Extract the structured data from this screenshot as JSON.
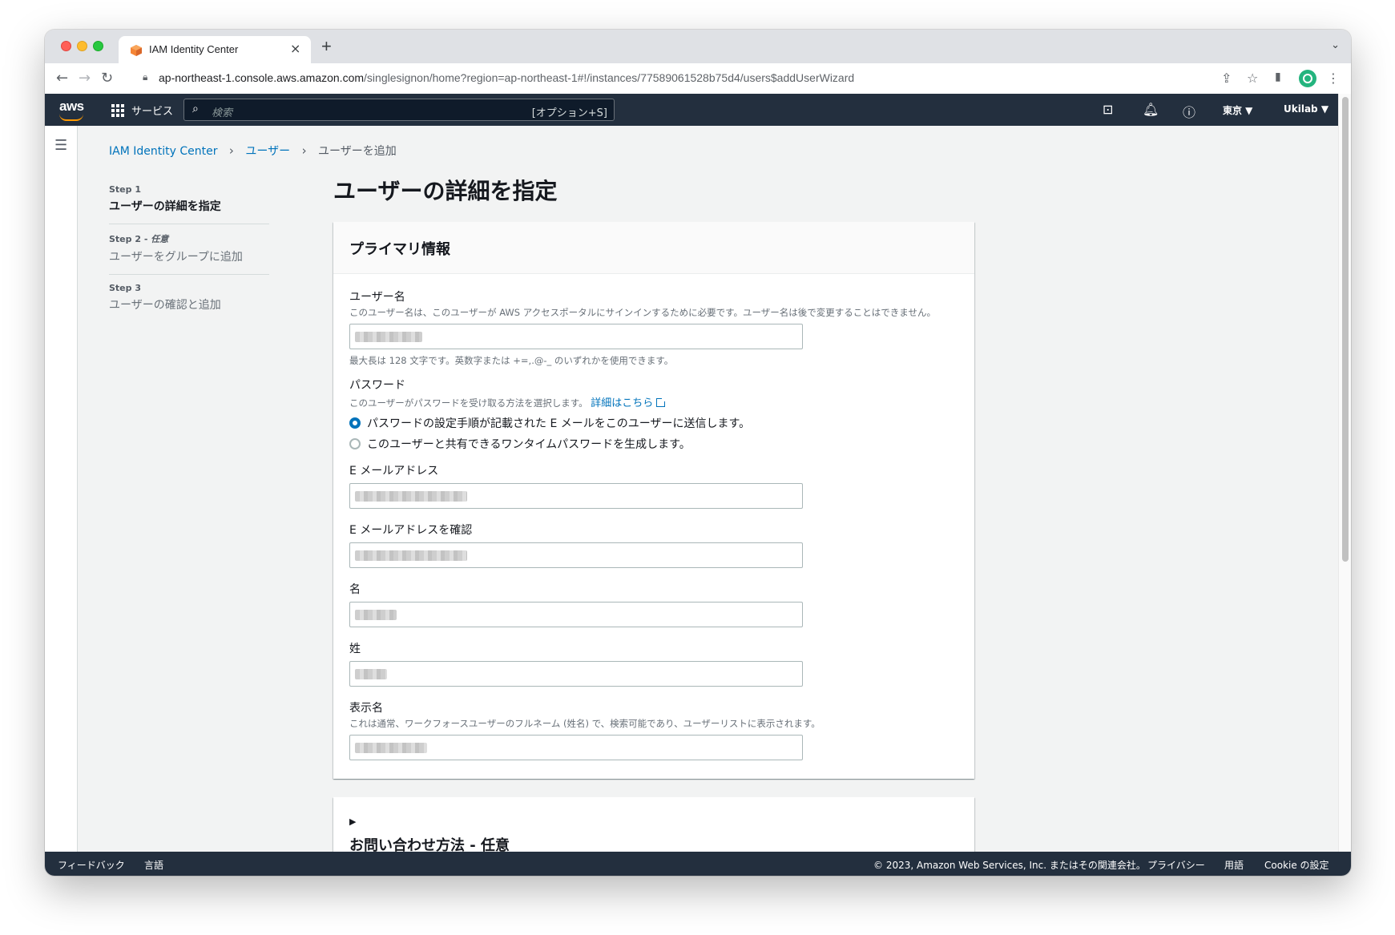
{
  "browser": {
    "tab_title": "IAM Identity Center",
    "url_host": "ap-northeast-1.console.aws.amazon.com",
    "url_path": "/singlesignon/home?region=ap-northeast-1#!/instances/77589061528b75d4/users$addUserWizard"
  },
  "aws_nav": {
    "logo": "aws",
    "services": "サービス",
    "search_placeholder": "検索",
    "search_shortcut": "[オプション+S]",
    "region": "東京 ▼",
    "account": "Ukilab ▼"
  },
  "breadcrumb": {
    "root": "IAM Identity Center",
    "users": "ユーザー",
    "current": "ユーザーを追加"
  },
  "steps": [
    {
      "num": "Step 1",
      "optional": "",
      "title": "ユーザーの詳細を指定"
    },
    {
      "num": "Step 2 - ",
      "optional": "任意",
      "title": "ユーザーをグループに追加"
    },
    {
      "num": "Step 3",
      "optional": "",
      "title": "ユーザーの確認と追加"
    }
  ],
  "page_title": "ユーザーの詳細を指定",
  "primary": {
    "title": "プライマリ情報",
    "username_label": "ユーザー名",
    "username_desc": "このユーザー名は、このユーザーが AWS アクセスポータルにサインインするために必要です。ユーザー名は後で変更することはできません。",
    "username_constraint": "最大長は 128 文字です。英数字または +=,.@-_ のいずれかを使用できます。",
    "password_label": "パスワード",
    "password_desc": "このユーザーがパスワードを受け取る方法を選択します。",
    "password_link": "詳細はこちら",
    "option_email": "パスワードの設定手順が記載された E メールをこのユーザーに送信します。",
    "option_otp": "このユーザーと共有できるワンタイムパスワードを生成します。",
    "email_label": "E メールアドレス",
    "email_confirm_label": "E メールアドレスを確認",
    "first_name_label": "名",
    "last_name_label": "姓",
    "display_name_label": "表示名",
    "display_name_desc": "これは通常、ワークフォースユーザーのフルネーム (姓名) で、検索可能であり、ユーザーリストに表示されます。"
  },
  "contact": {
    "title": "お問い合わせ方法 - 任意"
  },
  "footer": {
    "feedback": "フィードバック",
    "language": "言語",
    "copyright": "© 2023, Amazon Web Services, Inc. またはその関連会社。",
    "privacy": "プライバシー",
    "terms": "用語",
    "cookie": "Cookie の設定"
  }
}
